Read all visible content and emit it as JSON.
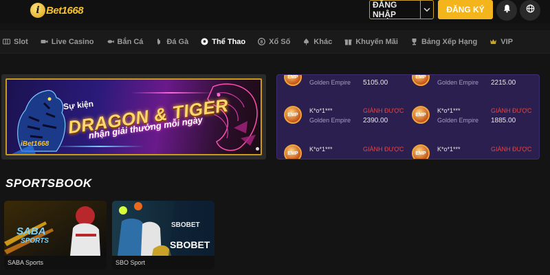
{
  "header": {
    "logo_text": "Bet1668",
    "logo_badge": "i",
    "login_label": "ĐĂNG NHẬP",
    "register_label": "ĐĂNG KÝ",
    "icons": [
      "chevron-down-icon",
      "bell-icon",
      "globe-icon"
    ]
  },
  "nav": {
    "items": [
      {
        "label": "Slot",
        "icon": "slot-icon"
      },
      {
        "label": "Live Casino",
        "icon": "camera-icon"
      },
      {
        "label": "Bắn Cá",
        "icon": "fish-icon"
      },
      {
        "label": "Đá Gà",
        "icon": "rooster-icon"
      },
      {
        "label": "Thể Thao",
        "icon": "soccer-ball-icon"
      },
      {
        "label": "Xổ Số",
        "icon": "lottery-icon"
      },
      {
        "label": "Khác",
        "icon": "spade-icon"
      },
      {
        "label": "Khuyến Mãi",
        "icon": "gift-icon"
      },
      {
        "label": "Bảng Xếp Hạng",
        "icon": "trophy-icon"
      },
      {
        "label": "VIP",
        "icon": "vip-icon"
      }
    ],
    "active": "Thể Thao"
  },
  "banner": {
    "line1": "Sự kiện",
    "line2": "DRAGON & TIGER",
    "line3": "nhận giải thưởng mỗi ngày",
    "logo_text": "iBet1668"
  },
  "winners": {
    "coin_label": "EMP",
    "rows": [
      {
        "user": "",
        "won_label": "",
        "game": "Golden Empire",
        "amount": "5105.00"
      },
      {
        "user": "",
        "won_label": "",
        "game": "Golden Empire",
        "amount": "2215.00"
      },
      {
        "user": "K*o*1***",
        "won_label": "GIÀNH ĐƯỢC",
        "game": "Golden Empire",
        "amount": "2390.00"
      },
      {
        "user": "K*o*1***",
        "won_label": "GIÀNH ĐƯỢC",
        "game": "Golden Empire",
        "amount": "1885.00"
      },
      {
        "user": "K*o*1***",
        "won_label": "GIÀNH ĐƯỢC",
        "game": "",
        "amount": ""
      },
      {
        "user": "K*o*1***",
        "won_label": "GIÀNH ĐƯỢC",
        "game": "",
        "amount": ""
      }
    ]
  },
  "sportsbook": {
    "title": "SPORTSBOOK",
    "cards": [
      {
        "label": "SABA Sports",
        "art_text": "SABA",
        "art_sub": "SPORTS"
      },
      {
        "label": "SBO Sport",
        "art_text": "SBOBET",
        "art_sub": "SBOBET"
      }
    ]
  },
  "colors": {
    "accent": "#f4b51c",
    "won": "#e0474c",
    "winners_bg": "#2a1f4e"
  }
}
